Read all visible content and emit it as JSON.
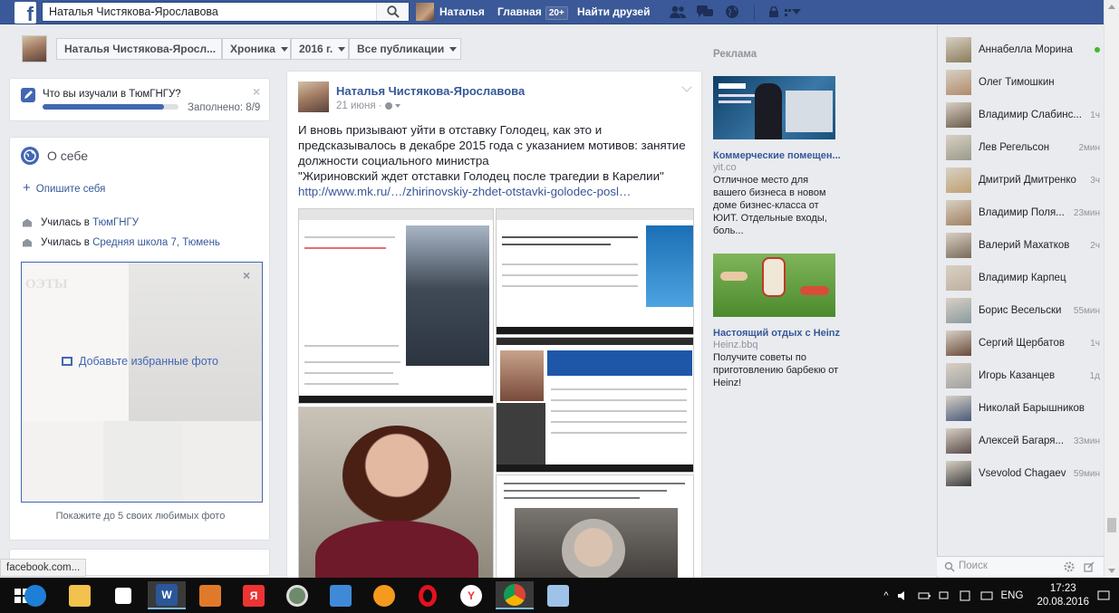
{
  "topbar": {
    "search_value": "Наталья Чистякова-Ярославова",
    "user_name": "Наталья",
    "home_label": "Главная",
    "home_badge": "20+",
    "find_friends": "Найти друзей"
  },
  "timeline_bar": {
    "profile_name": "Наталья Чистякова-Яросл...",
    "chronicle": "Хроника",
    "year": "2016 г.",
    "filter": "Все публикации"
  },
  "study_card": {
    "question": "Что вы изучали в ТюмГНГУ?",
    "progress_fraction": 0.89,
    "completed": "Заполнено: 8/9"
  },
  "about": {
    "title": "О себе",
    "describe_self": "Опишите себя",
    "edu1_prefix": "Училась в ",
    "edu1_link": "ТюмГНГУ",
    "edu2_prefix": "Училась в ",
    "edu2_link": "Средняя школа 7, Тюмень",
    "add_fav_photos": "Добавьте избранные фото",
    "show_hint": "Покажите до 5 своих любимых фото"
  },
  "post": {
    "author": "Наталья Чистякова-Ярославова",
    "date": "21 июня · ",
    "text": "И вновь призывают уйти в отставку Голодец, как это и предсказывалось в декабре 2015 года с указанием мотивов: занятие должности социального министра\n\"Жириновский ждет отставки Голодец после трагедии в Карелии\"",
    "link": "http://www.mk.ru/…/zhirinovskiy-zhdet-otstavki-golodec-posl…"
  },
  "ads": {
    "header": "Реклама",
    "items": [
      {
        "title": "Коммерческие помещен...",
        "domain": "yit.co",
        "desc": "Отличное место для вашего бизнеса в новом доме бизнес-класса от ЮИТ. Отдельные входы, боль..."
      },
      {
        "title": "Настоящий отдых с Heinz!",
        "domain": "Heinz.bbq",
        "desc": "Получите советы по приготовлению барбекю от Heinz!"
      }
    ]
  },
  "chat": {
    "contacts": [
      {
        "name": "Аннабелла Морина",
        "time": "",
        "online": true
      },
      {
        "name": "Олег Тимошкин",
        "time": "",
        "online": false
      },
      {
        "name": "Владимир Слабинс...",
        "time": "1ч",
        "online": false
      },
      {
        "name": "Лев Регельсон",
        "time": "2мин",
        "online": false
      },
      {
        "name": "Дмитрий Дмитренко",
        "time": "3ч",
        "online": false
      },
      {
        "name": "Владимир Поля...",
        "time": "23мин",
        "online": false
      },
      {
        "name": "Валерий Махатков",
        "time": "2ч",
        "online": false
      },
      {
        "name": "Владимир Карпец",
        "time": "",
        "online": false
      },
      {
        "name": "Борис Весельски",
        "time": "55мин",
        "online": false
      },
      {
        "name": "Сергий Щербатов",
        "time": "1ч",
        "online": false
      },
      {
        "name": "Игорь Казанцев",
        "time": "1д",
        "online": false
      },
      {
        "name": "Николай Барышников",
        "time": "",
        "online": false
      },
      {
        "name": "Алексей Багаря...",
        "time": "33мин",
        "online": false
      },
      {
        "name": "Vsevolod Chagaev",
        "time": "59мин",
        "online": false
      }
    ],
    "search_placeholder": "Поиск"
  },
  "statusbar": {
    "url": "facebook.com..."
  },
  "taskbar": {
    "lang": "ENG",
    "time": "17:23",
    "date": "20.08.2016"
  },
  "colors": {
    "fb_blue": "#3b5998",
    "link": "#365899",
    "accent": "#4267b2"
  }
}
